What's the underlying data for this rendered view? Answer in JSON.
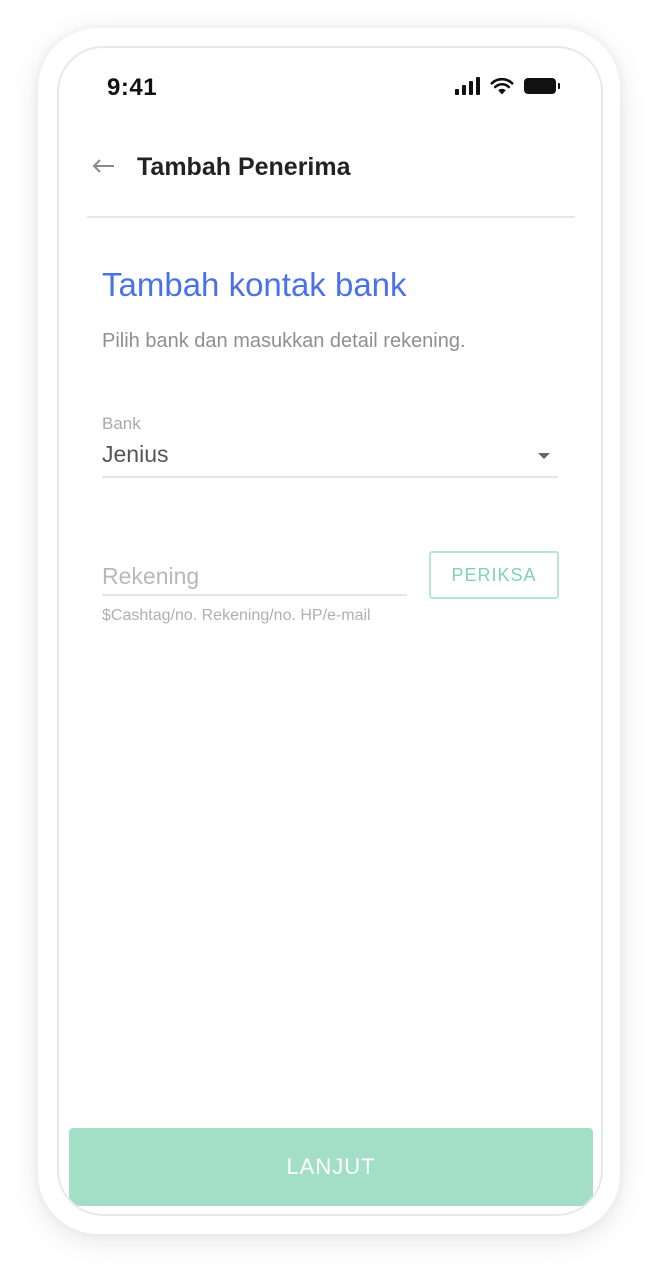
{
  "status_bar": {
    "time": "9:41",
    "icons": [
      "cellular-signal-icon",
      "wifi-icon",
      "battery-icon"
    ]
  },
  "header": {
    "back_icon": "arrow-left-icon",
    "title": "Tambah Penerima"
  },
  "form": {
    "title": "Tambah kontak bank",
    "subtitle": "Pilih bank dan masukkan detail rekening.",
    "bank": {
      "label": "Bank",
      "value": "Jenius",
      "icon": "caret-down-icon"
    },
    "account": {
      "placeholder": "Rekening",
      "value": "",
      "helper": "$Cashtag/no. Rekening/no. HP/e-mail"
    },
    "check_label": "PERIKSA"
  },
  "footer": {
    "continue_label": "LANJUT"
  },
  "colors": {
    "accent_blue": "#4a72e8",
    "mint": "#a3dfc6",
    "mint_outline": "#b7e6d2",
    "mint_text": "#7fd3b1"
  }
}
